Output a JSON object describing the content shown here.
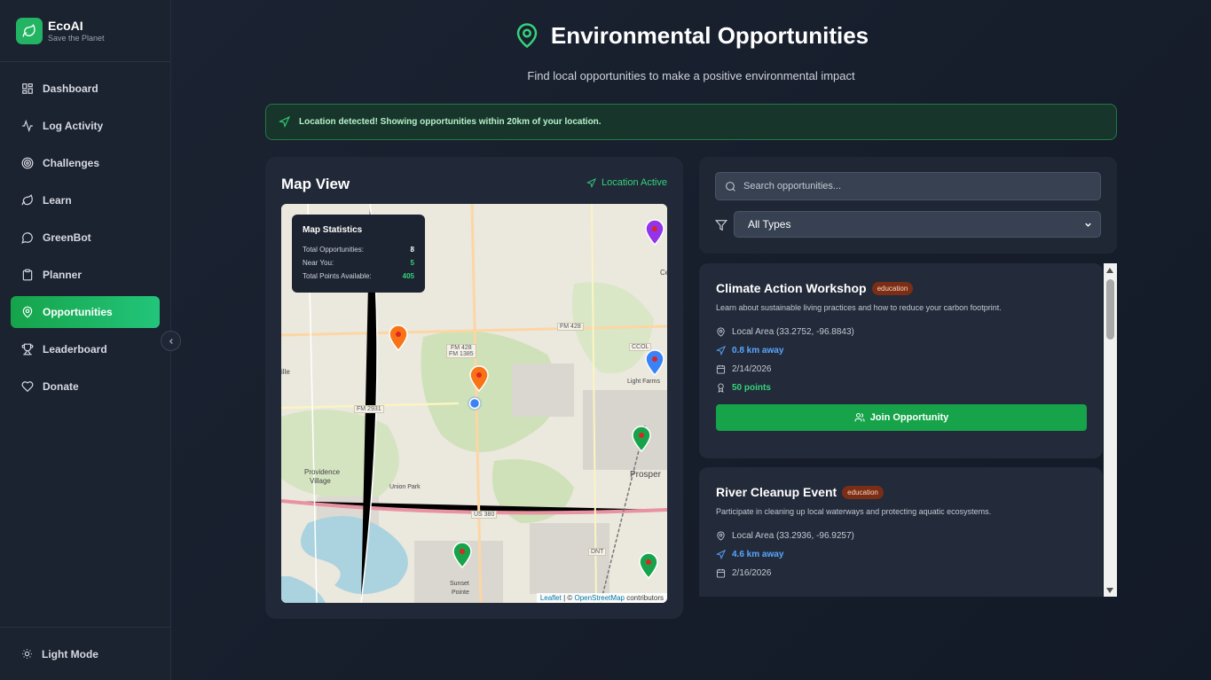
{
  "brand": {
    "name": "EcoAI",
    "tagline": "Save the Planet"
  },
  "sidebar": {
    "items": [
      {
        "label": "Dashboard",
        "icon": "grid-icon"
      },
      {
        "label": "Log Activity",
        "icon": "activity-icon"
      },
      {
        "label": "Challenges",
        "icon": "target-icon"
      },
      {
        "label": "Learn",
        "icon": "leaf-icon"
      },
      {
        "label": "GreenBot",
        "icon": "chat-icon"
      },
      {
        "label": "Planner",
        "icon": "clipboard-icon"
      },
      {
        "label": "Opportunities",
        "icon": "map-pin-icon",
        "active": true
      },
      {
        "label": "Leaderboard",
        "icon": "trophy-icon"
      },
      {
        "label": "Donate",
        "icon": "heart-icon"
      }
    ],
    "theme_toggle": "Light Mode"
  },
  "header": {
    "title": "Environmental Opportunities",
    "subtitle": "Find local opportunities to make a positive environmental impact"
  },
  "alert": {
    "text": "Location detected! Showing opportunities within 20km of your location."
  },
  "map": {
    "title": "Map View",
    "status": "Location Active",
    "stats": {
      "title": "Map Statistics",
      "total_label": "Total Opportunities:",
      "total_value": "8",
      "near_label": "Near You:",
      "near_value": "5",
      "points_label": "Total Points Available:",
      "points_value": "405"
    },
    "labels": {
      "fm428": "FM 428",
      "fm428b": "FM 428",
      "fm1385": "FM 1385",
      "fm2931": "FM 2931",
      "us380": "US 380",
      "dnt": "DNT",
      "ccol": "CCOL",
      "prosper": "Prosper",
      "providence": "Providence",
      "village": "Village",
      "union_park": "Union Park",
      "light_farms": "Light Farms",
      "sunset": "Sunset",
      "pointe": "Pointe",
      "ce": "Ce",
      "ille": "ille"
    },
    "attribution": {
      "leaflet": "Leaflet",
      "sep": " | © ",
      "osm": "OpenStreetMap",
      "suffix": " contributors"
    }
  },
  "search": {
    "placeholder": "Search opportunities..."
  },
  "filter": {
    "selected": "All Types"
  },
  "opportunities": [
    {
      "title": "Climate Action Workshop",
      "category": "education",
      "description": "Learn about sustainable living practices and how to reduce your carbon footprint.",
      "location": "Local Area (33.2752, -96.8843)",
      "distance": "0.8 km away",
      "date": "2/14/2026",
      "points": "50 points",
      "button": "Join Opportunity"
    },
    {
      "title": "River Cleanup Event",
      "category": "education",
      "description": "Participate in cleaning up local waterways and protecting aquatic ecosystems.",
      "location": "Local Area (33.2936, -96.9257)",
      "distance": "4.6 km away",
      "date": "2/16/2026"
    }
  ],
  "colors": {
    "accent": "#16a34a",
    "accent_text": "#34d37a",
    "distance": "#5aa5ff",
    "badge_bg": "#7a2e16"
  }
}
